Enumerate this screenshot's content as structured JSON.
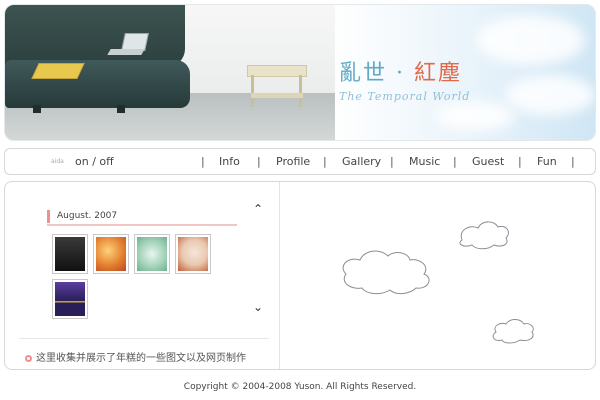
{
  "header": {
    "title_part1": "亂世",
    "title_dot": "·",
    "title_part2": "紅塵",
    "subtitle": "The Temporal World"
  },
  "nav": {
    "text_tag": "aida",
    "toggle_label": "on / off",
    "separator": "|",
    "items": [
      {
        "label": "Info"
      },
      {
        "label": "Profile"
      },
      {
        "label": "Gallery"
      },
      {
        "label": "Music"
      },
      {
        "label": "Guest"
      },
      {
        "label": "Fun"
      }
    ]
  },
  "gallery": {
    "date_label": "August. 2007",
    "up_arrow": "⌃",
    "down_arrow": "⌄",
    "thumbnails": [
      {
        "name": "dark-scene",
        "color": "#2b2b2b"
      },
      {
        "name": "orange-anime",
        "color": "#f1a43c"
      },
      {
        "name": "green-anime",
        "color": "#9fd0b6"
      },
      {
        "name": "redhead-girl",
        "color": "#e9c9b0"
      },
      {
        "name": "purple-banner",
        "color": "#3b2a6b"
      }
    ]
  },
  "note": {
    "text": "这里收集并展示了年糕的一些图文以及网页制作"
  },
  "footer": {
    "copyright": "Copyright © 2004-2008 Yuson. All Rights Reserved."
  },
  "colors": {
    "accent_pink": "#f08f8f",
    "title_blue": "#5fa8c6",
    "title_red": "#e06a4a",
    "sofa": "#2c413f"
  }
}
